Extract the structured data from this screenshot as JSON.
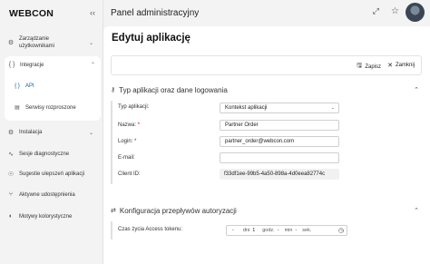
{
  "sidebar": {
    "logo": "WEBCON",
    "collapse_icon": "chevron-left-icon",
    "items": [
      {
        "icon": "users-gear-icon",
        "label": "Zarządzanie\nużytkownikami"
      },
      {
        "icon": "braces-icon",
        "label": "Integracje"
      },
      {
        "icon": "gear-icon",
        "label": "Instalacja"
      },
      {
        "icon": "pulse-icon",
        "label": "Sesje diagnostyczne"
      },
      {
        "icon": "lightbulb-icon",
        "label": "Sugestie ulepszeń aplikacji"
      },
      {
        "icon": "share-icon",
        "label": "Aktywne udostępnienia"
      },
      {
        "icon": "palette-icon",
        "label": "Motywy kolorystyczne"
      }
    ],
    "sub_items": [
      {
        "icon": "braces-icon",
        "label": "API"
      },
      {
        "icon": "server-icon",
        "label": "Serwisy rozproszone"
      }
    ]
  },
  "header": {
    "title": "Panel administracyjny",
    "icons": [
      "star-icon",
      "expand-icon",
      "avatar"
    ]
  },
  "main": {
    "page_title": "Edytuj aplikację",
    "toolbar": {
      "save_label": "Zapisz",
      "close_label": "Zamknij"
    },
    "section1": {
      "title": "Typ aplikacji oraz dane logowania",
      "fields": {
        "type_label": "Typ aplikacji:",
        "type_value": "Kontekst aplikacji",
        "name_label": "Nazwa:",
        "name_value": "Partner Order",
        "login_label": "Login:",
        "login_value": "partner_order@webcon.com",
        "email_label": "E-mail:",
        "email_value": "",
        "client_id_label": "Client ID:",
        "client_id_value": "f33df1ee-99b5-4a50-898a-4d0eea82774c"
      },
      "required_mark": "*"
    },
    "section2": {
      "title": "Konfiguracja przepływów autoryzacji",
      "token_label": "Czas życia Access tokenu:",
      "duration": {
        "sign": "-",
        "days_unit": "dni",
        "days_value": "1",
        "hours_unit": "godz.",
        "hours_value": "-",
        "minutes_unit": "min",
        "minutes_value": "-",
        "seconds_unit": "sek."
      }
    }
  }
}
